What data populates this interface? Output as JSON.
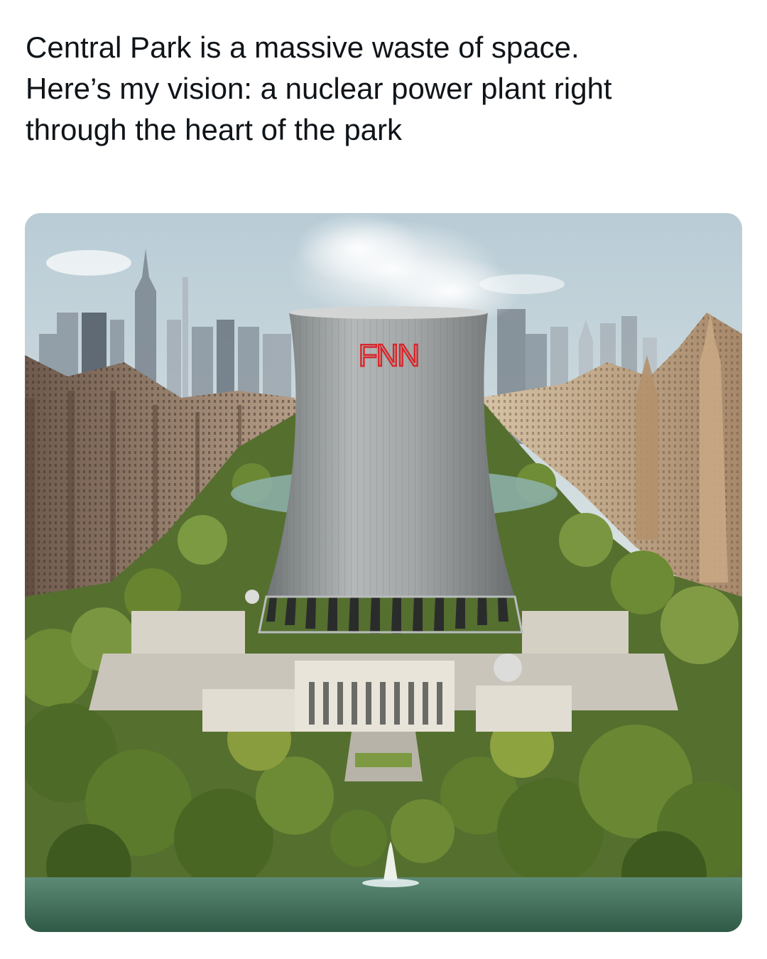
{
  "post": {
    "text_lines": [
      "Central Park is a massive waste of space.",
      "Here’s my vision: a nuclear power plant right",
      "through the heart of the park"
    ]
  },
  "image": {
    "tower_sign": "FNN",
    "colors": {
      "sky": "#cfdde3",
      "tower": "#9ea3a4",
      "sign": "#d8262b",
      "trees": "#4f6d2a",
      "water": "#46705c"
    }
  }
}
